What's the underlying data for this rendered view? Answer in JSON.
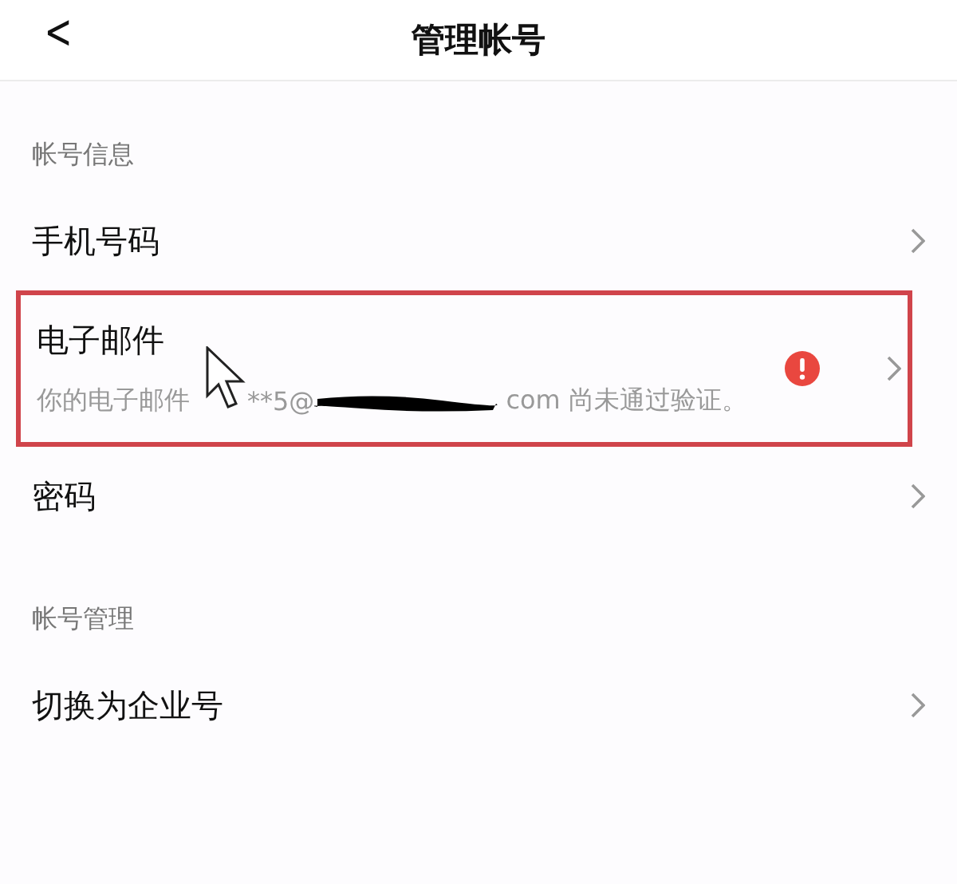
{
  "header": {
    "back_icon": "<",
    "title": "管理帐号"
  },
  "sections": [
    {
      "title": "帐号信息",
      "rows": [
        {
          "kind": "plain",
          "label": "手机号码"
        },
        {
          "kind": "warning",
          "label": "电子邮件",
          "highlighted": true,
          "message_start": "你的电子邮件",
          "message_middle": "**5@",
          "message_end": "com 尚未通过验证。"
        },
        {
          "kind": "plain",
          "label": "密码"
        }
      ]
    },
    {
      "title": "帐号管理",
      "rows": [
        {
          "kind": "plain",
          "label": "切换为企业号"
        }
      ]
    }
  ]
}
